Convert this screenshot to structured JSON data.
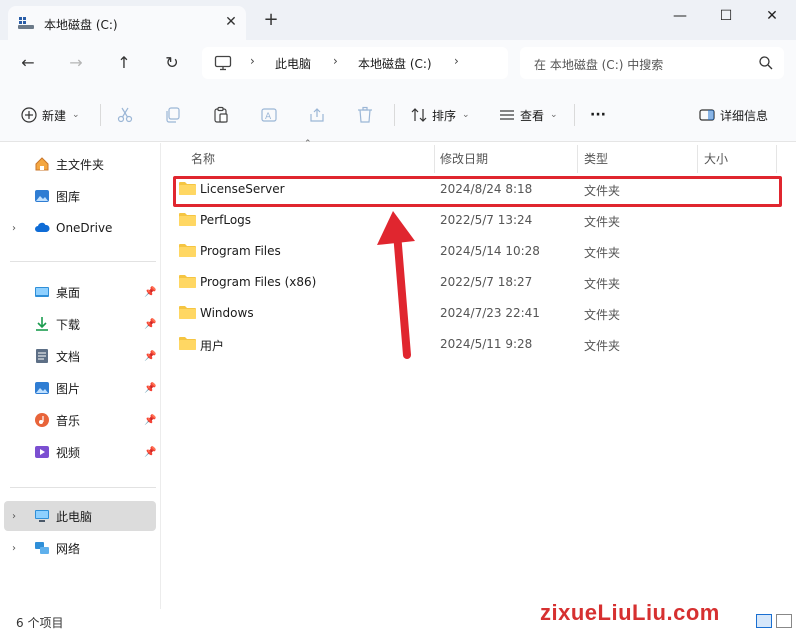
{
  "window": {
    "tab_title": "本地磁盘 (C:)",
    "tab_close": "✕",
    "new_tab": "+",
    "minimize": "—",
    "maximize": "☐",
    "close": "✕"
  },
  "nav": {
    "back": "←",
    "forward": "→",
    "up": "↑",
    "refresh": "↻",
    "breadcrumb": [
      "此电脑",
      "本地磁盘 (C:)"
    ],
    "search_placeholder": "在 本地磁盘 (C:) 中搜索"
  },
  "toolbar": {
    "new_label": "新建",
    "sort_label": "排序",
    "view_label": "查看",
    "more": "···",
    "details_label": "详细信息"
  },
  "sidebar": {
    "items": [
      {
        "label": "主文件夹",
        "icon": "home-icon",
        "chevron": false,
        "pinned": false
      },
      {
        "label": "图库",
        "icon": "gallery-icon",
        "chevron": false,
        "pinned": false
      },
      {
        "label": "OneDrive",
        "icon": "cloud-icon",
        "chevron": true,
        "pinned": false
      },
      {
        "label": "桌面",
        "icon": "desktop-icon",
        "chevron": false,
        "pinned": true
      },
      {
        "label": "下载",
        "icon": "download-icon",
        "chevron": false,
        "pinned": true
      },
      {
        "label": "文档",
        "icon": "document-icon",
        "chevron": false,
        "pinned": true
      },
      {
        "label": "图片",
        "icon": "picture-icon",
        "chevron": false,
        "pinned": true
      },
      {
        "label": "音乐",
        "icon": "music-icon",
        "chevron": false,
        "pinned": true
      },
      {
        "label": "视频",
        "icon": "video-icon",
        "chevron": false,
        "pinned": true
      },
      {
        "label": "此电脑",
        "icon": "computer-icon",
        "chevron": true,
        "pinned": false,
        "selected": true
      },
      {
        "label": "网络",
        "icon": "network-icon",
        "chevron": true,
        "pinned": false
      }
    ]
  },
  "columns": {
    "name": "名称",
    "date": "修改日期",
    "type": "类型",
    "size": "大小"
  },
  "files": [
    {
      "name": "LicenseServer",
      "date": "2024/8/24 8:18",
      "type": "文件夹"
    },
    {
      "name": "PerfLogs",
      "date": "2022/5/7 13:24",
      "type": "文件夹"
    },
    {
      "name": "Program Files",
      "date": "2024/5/14 10:28",
      "type": "文件夹"
    },
    {
      "name": "Program Files (x86)",
      "date": "2022/5/7 18:27",
      "type": "文件夹"
    },
    {
      "name": "Windows",
      "date": "2024/7/23 22:41",
      "type": "文件夹"
    },
    {
      "name": "用户",
      "date": "2024/5/11 9:28",
      "type": "文件夹"
    }
  ],
  "status": {
    "item_count": "6 个项目"
  },
  "watermark": "zixueLiuLiu.com",
  "colors": {
    "highlight": "#e0262f",
    "folder": "#f5c542",
    "accent": "#1a6fd1"
  }
}
